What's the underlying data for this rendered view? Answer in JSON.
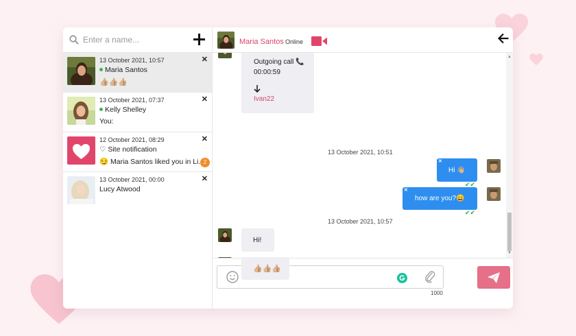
{
  "search": {
    "placeholder": "Enter a name..."
  },
  "conversations": [
    {
      "date": "13 October 2021, 10:57",
      "name": "Maria Santos",
      "message": "👍🏼👍🏼👍🏼",
      "online": true
    },
    {
      "date": "13 October 2021, 07:37",
      "name": "Kelly Shelley",
      "message": "You:",
      "online": true
    },
    {
      "date": "12 October 2021, 08:29",
      "name": "♡ Site notification",
      "message": "😏 Maria Santos liked you in Li...",
      "badge": "2"
    },
    {
      "date": "13 October 2021, 00:00",
      "name": "Lucy Atwood",
      "message": ""
    }
  ],
  "header": {
    "name": "Maria Santos",
    "status": "Online"
  },
  "messages": {
    "call_label": "Outgoing call",
    "call_duration": "00:00:59",
    "call_user": "Ivan22",
    "timestamp1": "13 October 2021, 10:51",
    "out1": "Hi 👋🏼",
    "out2": "how are you?😄",
    "timestamp2": "13 October 2021, 10:57",
    "in1": "Hi!",
    "in2": "👍🏼👍🏼👍🏼"
  },
  "composer": {
    "counter": "1000"
  },
  "colors": {
    "accent": "#d8456b",
    "bubble_out": "#2e8ef0",
    "send": "#e57088",
    "online": "#3cb54a",
    "background": "#fdf1f4"
  }
}
